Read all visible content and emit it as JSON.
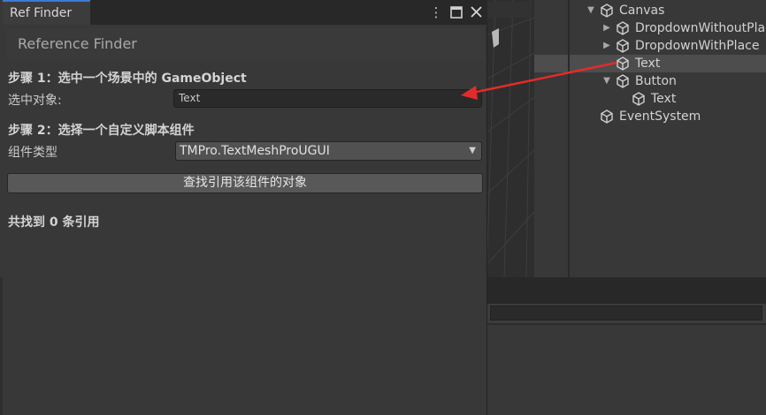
{
  "window": {
    "tab_title": "Ref Finder",
    "header_title": "Reference Finder",
    "step1_title": "步骤 1：选中一个场景中的 GameObject",
    "selected_object_label": "选中对象:",
    "selected_object_value": "Text",
    "step2_title": "步骤 2：选择一个自定义脚本组件",
    "component_type_label": "组件类型",
    "component_type_value": "TMPro.TextMeshProUGUI",
    "find_button_label": "查找引用该组件的对象",
    "result_text": "共找到 0 条引用"
  },
  "icons": {
    "menu": "kebab-menu-icon",
    "maximize": "maximize-icon",
    "close": "close-icon",
    "dropdown": "dropdown-triangle-icon",
    "game_object": "cube-icon",
    "foldout": "foldout-triangle-icon"
  },
  "hierarchy": {
    "items": [
      {
        "label": "Canvas",
        "expanded": true,
        "selected": false
      },
      {
        "label": "DropdownWithoutPla",
        "expanded": false,
        "selected": false
      },
      {
        "label": "DropdownWithPlace",
        "expanded": false,
        "selected": false
      },
      {
        "label": "Text",
        "expanded": null,
        "selected": true
      },
      {
        "label": "Button",
        "expanded": true,
        "selected": false
      },
      {
        "label": "Text",
        "expanded": null,
        "selected": false
      },
      {
        "label": "EventSystem",
        "expanded": null,
        "selected": false
      }
    ]
  },
  "colors": {
    "tab_accent": "#3b7ad6",
    "annotation_arrow": "#e32b2b",
    "window_background": "#383838"
  }
}
